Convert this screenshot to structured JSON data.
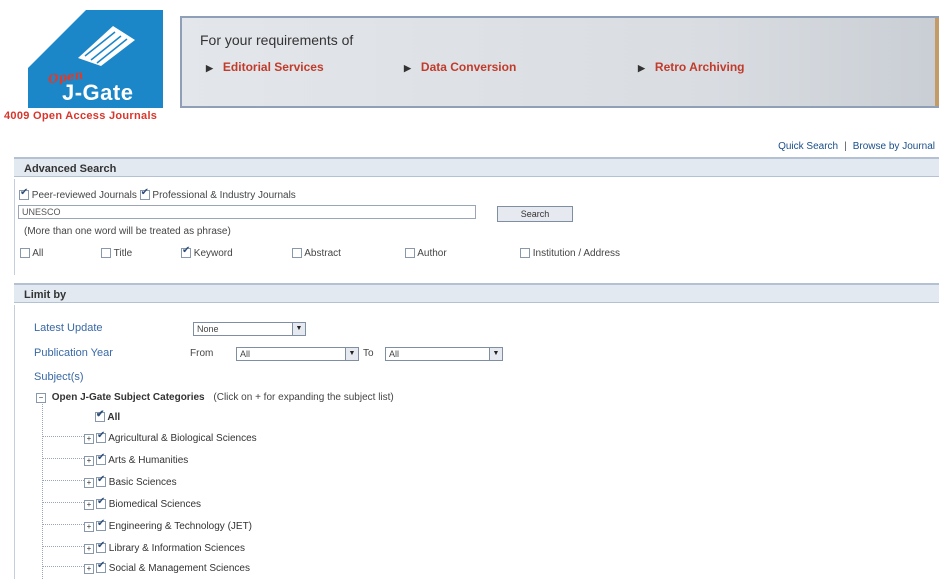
{
  "logo": {
    "script_text": "Open",
    "brand_text": "J-Gate"
  },
  "tagline": "4009 Open Access Journals",
  "banner": {
    "title": "For your requirements of",
    "items": [
      "Editorial Services",
      "Data Conversion",
      "Retro Archiving"
    ]
  },
  "links": {
    "quick_search": "Quick Search",
    "separator": "|",
    "browse": "Browse by Journal"
  },
  "advanced": {
    "title": "Advanced Search",
    "peer_reviewed": "Peer-reviewed Journals",
    "professional": "Professional & Industry Journals",
    "query_value": "UNESCO",
    "search_button": "Search",
    "hint": "(More than one word will be treated as phrase)",
    "fields": [
      {
        "label": "All",
        "checked": false
      },
      {
        "label": "Title",
        "checked": false
      },
      {
        "label": "Keyword",
        "checked": true
      },
      {
        "label": "Abstract",
        "checked": false
      },
      {
        "label": "Author",
        "checked": false
      },
      {
        "label": "Institution / Address",
        "checked": false
      }
    ]
  },
  "limit": {
    "title": "Limit by",
    "latest_update_label": "Latest Update",
    "latest_update_value": "None",
    "pub_year_label": "Publication Year",
    "from_label": "From",
    "from_value": "All",
    "to_label": "To",
    "to_value": "All",
    "subjects_label": "Subject(s)"
  },
  "tree": {
    "root_label": "Open J-Gate Subject Categories",
    "root_hint": "(Click on + for expanding the subject list)",
    "all_label": "All",
    "items": [
      "Agricultural & Biological Sciences",
      "Arts & Humanities",
      "Basic Sciences",
      "Biomedical Sciences",
      "Engineering & Technology (JET)",
      "Library & Information Sciences",
      "Social & Management Sciences"
    ]
  },
  "colors": {
    "logo_blue": "#1b86c8",
    "accent_red": "#d9352b",
    "link_blue": "#3868a6"
  }
}
